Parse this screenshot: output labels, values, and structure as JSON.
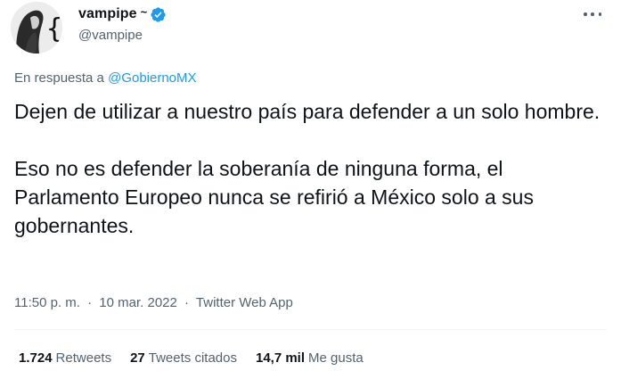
{
  "author": {
    "display_name": "vampipe",
    "name_suffix": "~",
    "handle": "@vampipe",
    "verified": true,
    "avatar_icon": "profile-avatar-icon",
    "verified_icon": "verified-badge-icon",
    "verified_color": "#1d9bf0"
  },
  "menu": {
    "icon": "more-options-icon"
  },
  "reply": {
    "prefix": "En respuesta a",
    "mention": "@GobiernoMX"
  },
  "tweet": {
    "paragraphs": [
      "Dejen de utilizar a nuestro país para defender a un solo hombre.",
      "Eso no es defender la soberanía de ninguna forma, el Parlamento Europeo nunca se refirió a México solo a sus gobernantes."
    ]
  },
  "meta": {
    "time": "11:50 p. m.",
    "separator": "·",
    "date": "10 mar. 2022",
    "source": "Twitter Web App"
  },
  "stats": {
    "retweets_count": "1.724",
    "retweets_label": "Retweets",
    "quotes_count": "27",
    "quotes_label": "Tweets citados",
    "likes_count": "14,7 mil",
    "likes_label": "Me gusta"
  },
  "colors": {
    "text": "#0f1419",
    "secondary": "#536471",
    "link": "#1d9bf0",
    "divider": "#eff3f4"
  }
}
